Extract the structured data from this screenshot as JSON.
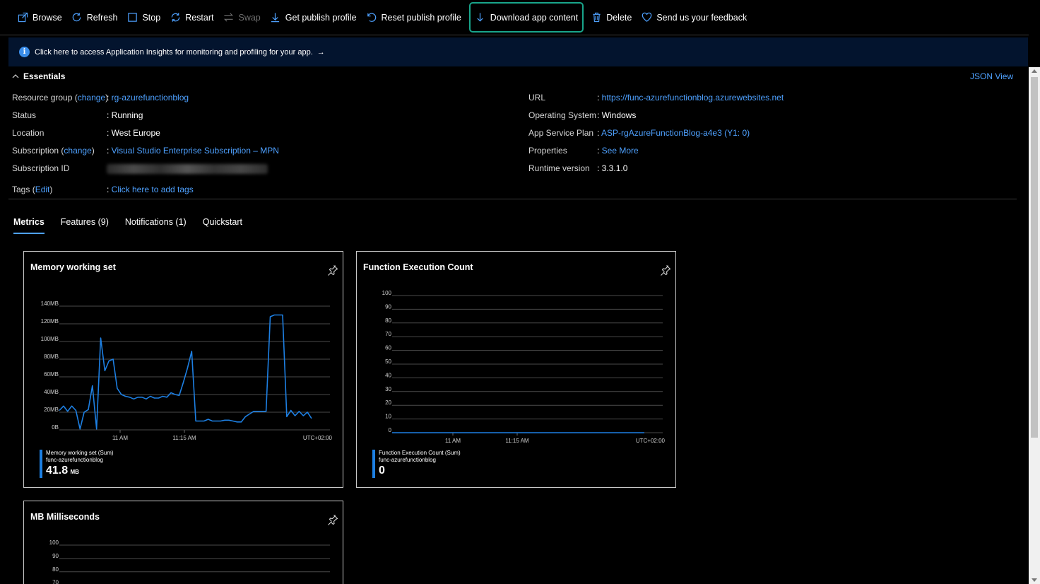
{
  "toolbar": {
    "browse": "Browse",
    "refresh": "Refresh",
    "stop": "Stop",
    "restart": "Restart",
    "swap": "Swap",
    "get_publish_profile": "Get publish profile",
    "reset_publish_profile": "Reset publish profile",
    "download_app_content": "Download app content",
    "delete": "Delete",
    "feedback": "Send us your feedback"
  },
  "banner": {
    "text": "Click here to access Application Insights for monitoring and profiling for your app.",
    "arrow": "→"
  },
  "essentials": {
    "title": "Essentials",
    "json_view": "JSON View",
    "left": {
      "resource_group_label": "Resource group",
      "resource_group_change": "change",
      "resource_group_value": "rg-azurefunctionblog",
      "status_label": "Status",
      "status_value": "Running",
      "location_label": "Location",
      "location_value": "West Europe",
      "subscription_label": "Subscription",
      "subscription_change": "change",
      "subscription_value": "Visual Studio Enterprise Subscription – MPN",
      "subscription_id_label": "Subscription ID",
      "tags_label": "Tags",
      "tags_edit": "Edit",
      "tags_value": "Click here to add tags"
    },
    "right": {
      "url_label": "URL",
      "url_value": "https://func-azurefunctionblog.azurewebsites.net",
      "os_label": "Operating System",
      "os_value": "Windows",
      "plan_label": "App Service Plan",
      "plan_value": "ASP-rgAzureFunctionBlog-a4e3 (Y1: 0)",
      "properties_label": "Properties",
      "properties_value": "See More",
      "runtime_label": "Runtime version",
      "runtime_value": "3.3.1.0"
    }
  },
  "tabs": [
    {
      "label": "Metrics"
    },
    {
      "label": "Features (9)"
    },
    {
      "label": "Notifications (1)"
    },
    {
      "label": "Quickstart"
    }
  ],
  "colors": {
    "accent": "#4ea1ff",
    "series": "#1d7fe2",
    "highlight": "#19a58b",
    "banner": "#03142e"
  },
  "chart_data": [
    {
      "type": "line",
      "title": "Memory working set",
      "y_tick_labels": [
        "140MB",
        "120MB",
        "100MB",
        "80MB",
        "60MB",
        "40MB",
        "20MB",
        "0B"
      ],
      "ylim": [
        0,
        140
      ],
      "x_tick_labels": [
        "11 AM",
        "11:15 AM"
      ],
      "timezone": "UTC+02:00",
      "legend_line1": "Memory working set (Sum)",
      "legend_line2": "func-azurefunctionblog",
      "summary_value": "41.8",
      "summary_unit": "MB",
      "series": [
        {
          "values": [
            22,
            27,
            21,
            27,
            22,
            1,
            20,
            23,
            50,
            1,
            104,
            67,
            78,
            80,
            47,
            40,
            38,
            37,
            35,
            37,
            37,
            35,
            38,
            36,
            36,
            38,
            37,
            42,
            40,
            39,
            54,
            70,
            89,
            10,
            10,
            10,
            12,
            10,
            10,
            10,
            11,
            11,
            10,
            9,
            9,
            15,
            18,
            21,
            21,
            21,
            21,
            128,
            130,
            130,
            130,
            15,
            22,
            16,
            21,
            16,
            20,
            13
          ]
        }
      ]
    },
    {
      "type": "line",
      "title": "Function Execution Count",
      "y_tick_labels": [
        "100",
        "90",
        "80",
        "70",
        "60",
        "50",
        "40",
        "30",
        "20",
        "10",
        "0"
      ],
      "ylim": [
        0,
        100
      ],
      "x_tick_labels": [
        "11 AM",
        "11:15 AM"
      ],
      "timezone": "UTC+02:00",
      "legend_line1": "Function Execution Count (Sum)",
      "legend_line2": "func-azurefunctionblog",
      "summary_value": "0",
      "series": [
        {
          "values": [
            0,
            0,
            0,
            0,
            0,
            0,
            0,
            0,
            0,
            0,
            0,
            0,
            0,
            0,
            0,
            0,
            0,
            0,
            0,
            0
          ]
        }
      ]
    },
    {
      "type": "line",
      "title": "MB Milliseconds",
      "y_tick_labels": [
        "100",
        "90",
        "80",
        "70"
      ],
      "ylim": [
        0,
        100
      ]
    }
  ]
}
